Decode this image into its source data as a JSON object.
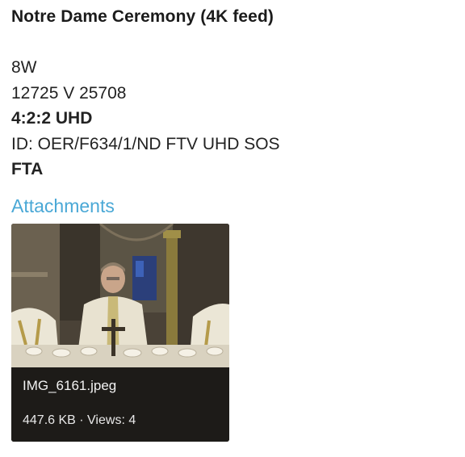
{
  "post": {
    "title": "Notre Dame Ceremony (4K feed)",
    "lines": {
      "line1": "8W",
      "line2": "12725 V 25708",
      "line3": "4:2:2 UHD",
      "line4": "ID: OER/F634/1/ND FTV UHD SOS",
      "line5": "FTA"
    }
  },
  "attachments": {
    "heading": "Attachments",
    "heading_color": "#4aa8d6",
    "items": [
      {
        "file_name": "IMG_6161.jpeg",
        "meta": "447.6 KB · Views: 4",
        "thumbnail_icon": "image-thumbnail"
      }
    ]
  }
}
